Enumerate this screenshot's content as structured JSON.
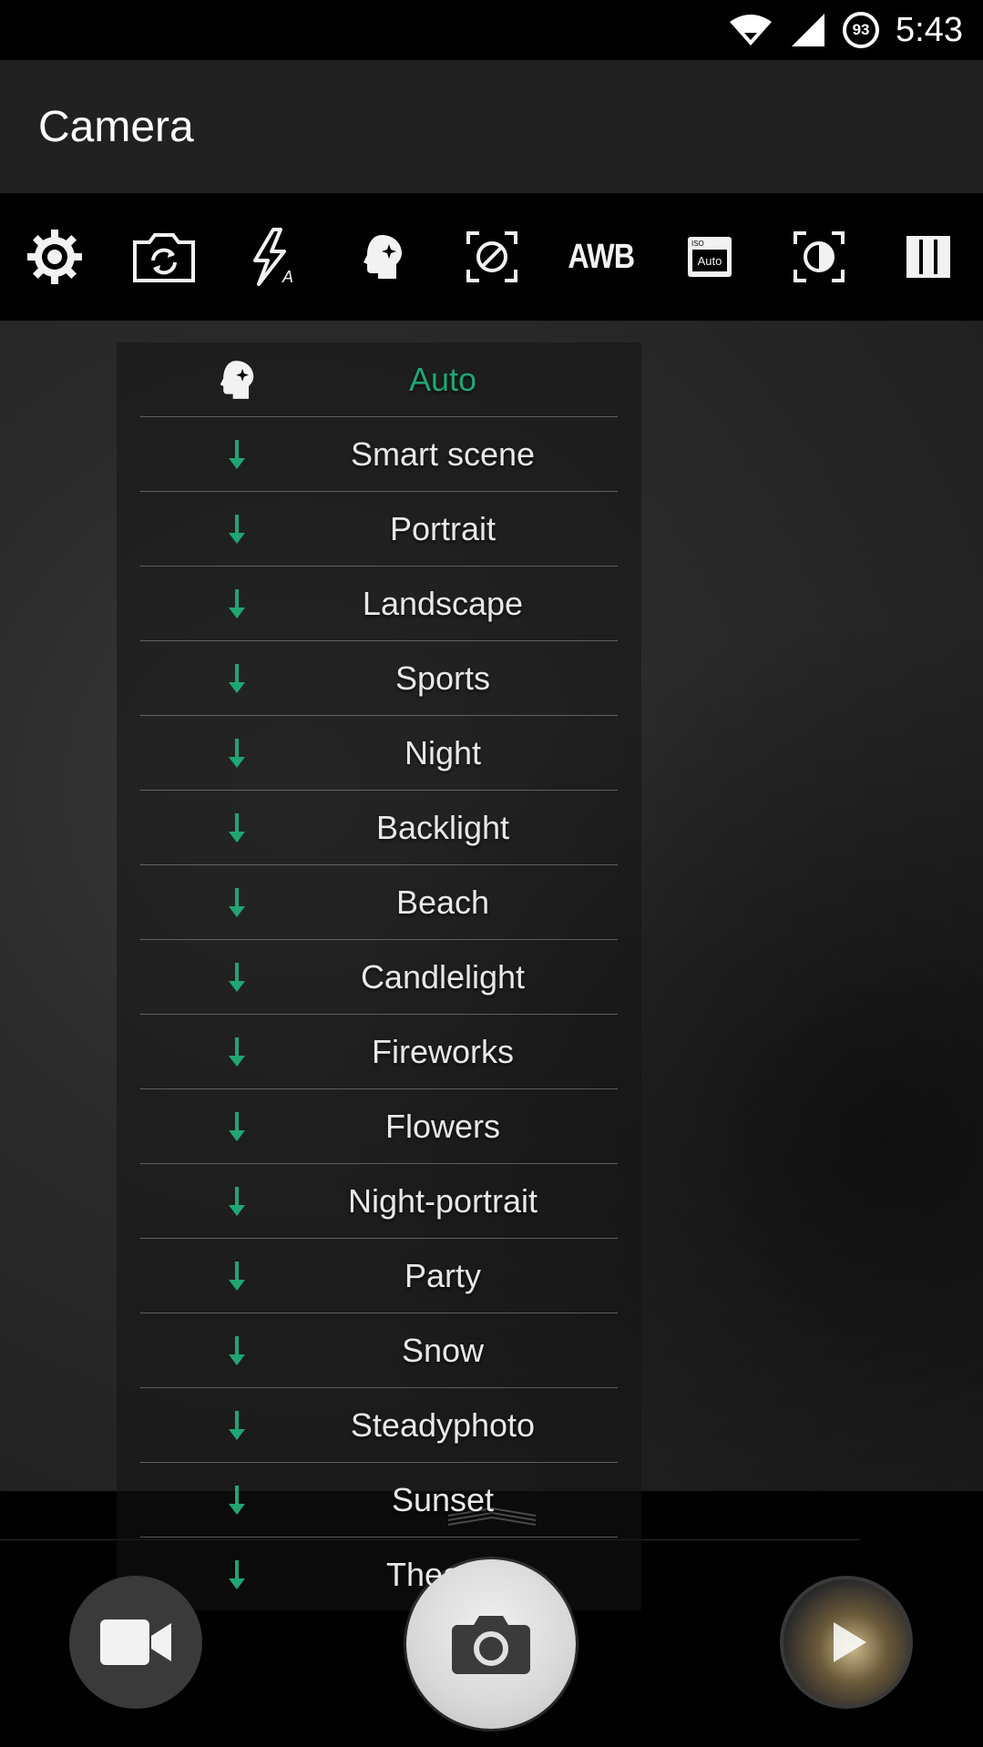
{
  "status_bar": {
    "battery": "93",
    "time": "5:43",
    "icons": [
      "wifi-icon",
      "signal-icon",
      "battery-icon"
    ]
  },
  "app_bar": {
    "title": "Camera"
  },
  "toolbar": {
    "awb_label": "AWB",
    "iso_top": "ISO",
    "iso_value": "Auto",
    "icons": [
      "settings-icon",
      "switch-camera-icon",
      "flash-auto-icon",
      "scene-mode-icon",
      "focus-off-icon",
      "white-balance",
      "iso-icon",
      "exposure-icon",
      "grid-icon"
    ]
  },
  "scene_menu": {
    "accent": "#1fa672",
    "items": [
      {
        "label": "Auto",
        "selected": true
      },
      {
        "label": "Smart scene"
      },
      {
        "label": "Portrait"
      },
      {
        "label": "Landscape"
      },
      {
        "label": "Sports"
      },
      {
        "label": "Night"
      },
      {
        "label": "Backlight"
      },
      {
        "label": "Beach"
      },
      {
        "label": "Candlelight"
      },
      {
        "label": "Fireworks"
      },
      {
        "label": "Flowers"
      },
      {
        "label": "Night-portrait"
      },
      {
        "label": "Party"
      },
      {
        "label": "Snow"
      },
      {
        "label": "Steadyphoto"
      },
      {
        "label": "Sunset"
      },
      {
        "label": "Theatre"
      }
    ]
  },
  "controls": {
    "icons": [
      "video-camera-icon",
      "shutter-camera-icon",
      "gallery-play-icon"
    ]
  }
}
